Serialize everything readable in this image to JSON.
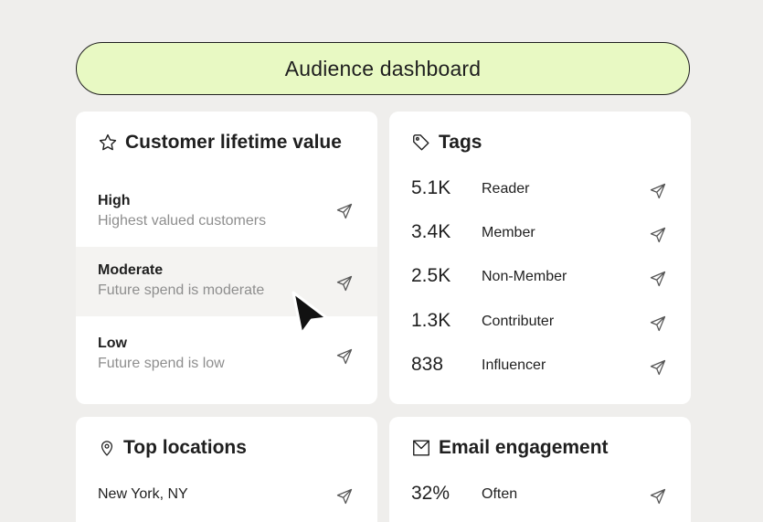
{
  "header": {
    "title": "Audience dashboard"
  },
  "clv": {
    "title": "Customer lifetime value",
    "icon": "star-icon",
    "items": [
      {
        "title": "High",
        "subtitle": "Highest valued customers"
      },
      {
        "title": "Moderate",
        "subtitle": "Future spend is moderate"
      },
      {
        "title": "Low",
        "subtitle": "Future spend is low"
      }
    ]
  },
  "tags": {
    "title": "Tags",
    "icon": "tag-icon",
    "items": [
      {
        "count": "5.1K",
        "label": "Reader"
      },
      {
        "count": "3.4K",
        "label": "Member"
      },
      {
        "count": "2.5K",
        "label": "Non-Member"
      },
      {
        "count": "1.3K",
        "label": "Contributer"
      },
      {
        "count": "838",
        "label": "Influencer"
      }
    ]
  },
  "locations": {
    "title": "Top locations",
    "icon": "location-pin-icon",
    "items": [
      {
        "label": "New York, NY"
      }
    ]
  },
  "email": {
    "title": "Email engagement",
    "icon": "envelope-icon",
    "items": [
      {
        "count": "32%",
        "label": "Often"
      }
    ]
  },
  "colors": {
    "background": "#efeeec",
    "title_pill": "#e8f9c3",
    "card": "#ffffff",
    "hover_row": "#f4f3f1",
    "muted_text": "#8e8e8e"
  }
}
